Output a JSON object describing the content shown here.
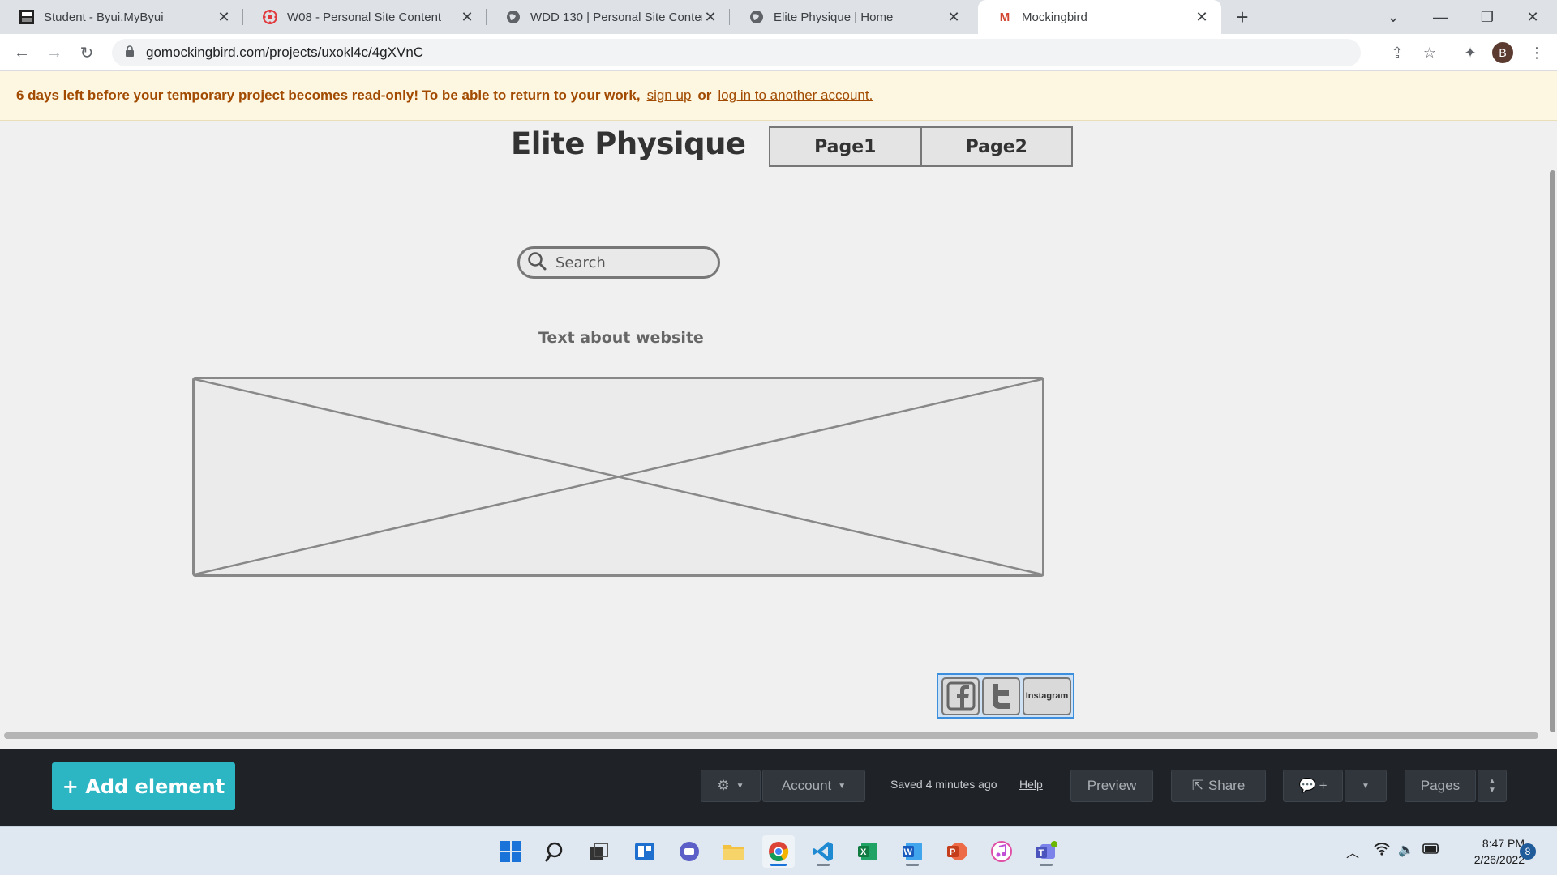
{
  "browser": {
    "tabs": [
      {
        "title": "Student - Byui.MyByui",
        "favicon": "byui-icon"
      },
      {
        "title": "W08 - Personal Site Content",
        "favicon": "canvas-icon"
      },
      {
        "title": "WDD 130 | Personal Site Content",
        "favicon": "globe-icon"
      },
      {
        "title": "Elite Physique | Home",
        "favicon": "globe-icon"
      },
      {
        "title": "Mockingbird",
        "favicon": "mockingbird-icon",
        "favicon_text": "M"
      }
    ],
    "new_tab": "+",
    "url": "gomockingbird.com/projects/uxokl4c/4gXVnC",
    "profile_initial": "B"
  },
  "banner": {
    "message": "6 days left before your temporary project becomes read-only! To be able to return to your work,",
    "signup": "sign up",
    "or": "or",
    "login": "log in to another account."
  },
  "mockup": {
    "site_title": "Elite Physique",
    "nav": [
      "Page1",
      "Page2"
    ],
    "search_placeholder": "Search",
    "text_about": "Text about website",
    "social": {
      "instagram": "Instagram"
    }
  },
  "toolbar": {
    "add_element": "+ Add element",
    "account": "Account",
    "saved": "Saved 4 minutes ago",
    "help": "Help",
    "preview": "Preview",
    "share": "Share",
    "comment_plus": "+",
    "pages": "Pages"
  },
  "taskbar": {
    "time": "8:47 PM",
    "date": "2/26/2022",
    "notification_count": "8"
  },
  "colors": {
    "accent_button": "#2cb5c3",
    "banner_text": "#a14a00",
    "banner_bg": "#fdf7e1",
    "selection": "#3b8fdc"
  }
}
